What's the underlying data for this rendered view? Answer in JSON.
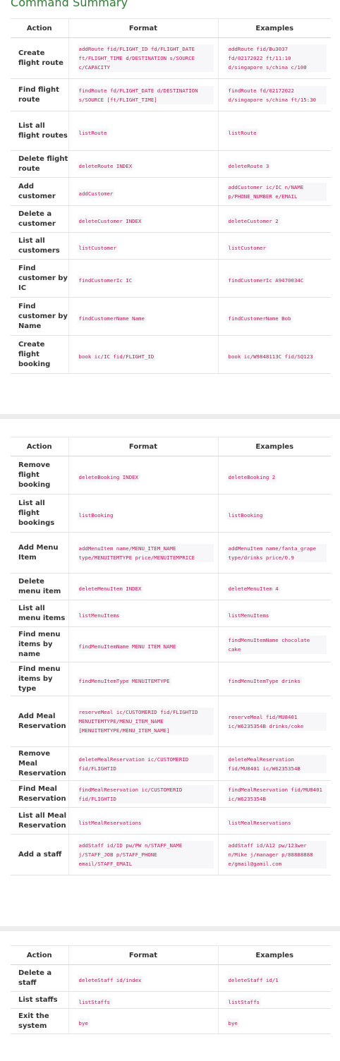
{
  "title": "Command Summary",
  "headers": {
    "action": "Action",
    "format": "Format",
    "examples": "Examples"
  },
  "table1": [
    {
      "action": "Create flight route",
      "format": "addRoute fid/FLIGHT_ID fd/FLIGHT_DATE ft/FLIGHT_TIME d/DESTINATION s/SOURCE c/CAPACITY",
      "example": "addRoute fid/Bu3037 fd/02172022 ft/11:10 d/singapore s/china c/100"
    },
    {
      "action": "Find flight route",
      "format": "findRoute fd/FLIGHT_DATE d/DESTINATION s/SOURCE [ft/FLIGHT_TIME]",
      "example": "findRoute fd/02172022 d/singapore s/china ft/15:30"
    },
    {
      "action": "List all flight routes",
      "format": "listRoute",
      "example": "listRoute"
    },
    {
      "action": "Delete flight route",
      "format": "deleteRoute INDEX",
      "example": "deleteRoute 3"
    },
    {
      "action": "Add customer",
      "format": "addCustomer",
      "example": "addCustomer ic/IC n/NAME p/PHONE_NUMBER e/EMAIL"
    },
    {
      "action": "Delete a customer",
      "format": "deleteCustomer INDEX",
      "example": "deleteCustomer 2"
    },
    {
      "action": "List all customers",
      "format": "listCustomer",
      "example": "listCustomer"
    },
    {
      "action": "Find customer by IC",
      "format": "findCustomerIc IC",
      "example": "findCustomerIc A9470034C"
    },
    {
      "action": "Find customer by Name",
      "format": "findCustomerName Name",
      "example": "findCustomerName Bob"
    },
    {
      "action": "Create flight booking",
      "format": "book ic/IC fid/FLIGHT_ID",
      "example": "book ic/W9848113C fid/SQ123"
    }
  ],
  "table2": [
    {
      "action": "Remove flight booking",
      "format": "deleteBooking INDEX",
      "example": "deleteBooking 2"
    },
    {
      "action": "List all flight bookings",
      "format": "listBooking",
      "example": "listBooking"
    },
    {
      "action": "Add Menu Item",
      "format": "addMenuItem name/MENU_ITEM_NAME type/MENUITEMTYPE price/MENUITEMPRICE",
      "example": "addMenuItem name/fanta_grape type/drinks price/0.9"
    },
    {
      "action": "Delete menu item",
      "format": "deleteMenuItem INDEX",
      "example": "deleteMenuItem 4"
    },
    {
      "action": "List all menu items",
      "format": "listMenuItems",
      "example": "listMenuItems"
    },
    {
      "action": "Find menu items by name",
      "format": "findMenuItemName MENU ITEM NAME",
      "example": "findMenuItemName chocolate cake"
    },
    {
      "action": "Find menu items by type",
      "format": "findMenuItemType MENUITEMTYPE",
      "example": "findMenuItemType drinks"
    },
    {
      "action": "Add Meal Reservation",
      "format": "reserveMeal ic/CUSTOMERID fid/FLIGHTID MENUITEMTYPE/MENU_ITEM_NAME [MENUITEMTYPE/MENU_ITEM_NAME]",
      "example": "reserveMeal fid/MU8401 ic/W6235354B drinks/coke"
    },
    {
      "action": "Remove Meal Reservation",
      "format": "deleteMealReservation ic/CUSTOMERID fid/FLIGHTID",
      "example": "deleteMealReservation fid/MU8401 ic/W6235354B"
    },
    {
      "action": "Find Meal Reservation",
      "format": "findMealReservation ic/CUSTOMERID fid/FLIGHTID",
      "example": "findMealReservation fid/MU8401 ic/W6235354B"
    },
    {
      "action": "List all Meal Reservation",
      "format": "listMealReservations",
      "example": "listMealReservations"
    },
    {
      "action": "Add a staff",
      "format": "addStaff id/ID pw/PW n/STAFF_NAME j/STAFF_JOB p/STAFF_PHONE email/STAFF_EMAIL",
      "example": "addStaff id/A12 pw/123wer n/Mike j/manager p/88888888 e/gmail@gamil.com"
    }
  ],
  "table3": [
    {
      "action": "Delete a staff",
      "format": "deleteStaff id/index",
      "example": "deleteStaff id/1"
    },
    {
      "action": "List staffs",
      "format": "listStaffs",
      "example": "listStaffs"
    },
    {
      "action": "Exit the system",
      "format": "bye",
      "example": "bye"
    }
  ]
}
